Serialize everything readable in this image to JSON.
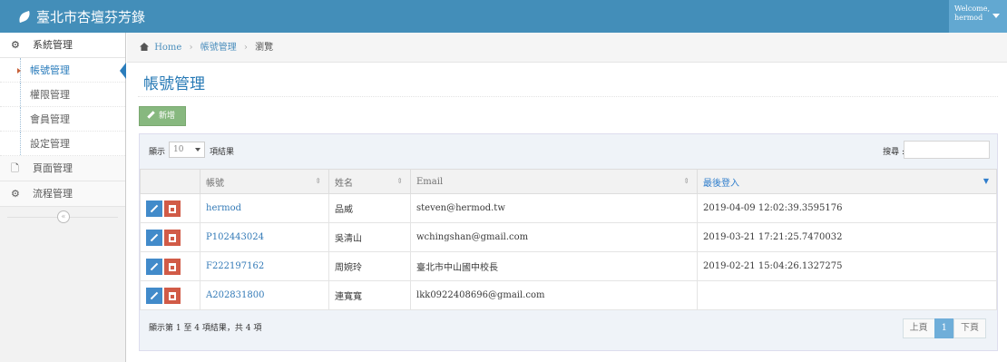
{
  "app": {
    "title": "臺北市杏壇芬芳錄"
  },
  "user_menu": {
    "welcome": "Welcome,",
    "username": "hermod"
  },
  "sidebar": {
    "system": "系統管理",
    "sub_items": [
      "帳號管理",
      "權限管理",
      "會員管理",
      "設定管理"
    ],
    "page_mgmt": "頁面管理",
    "flow_mgmt": "流程管理"
  },
  "breadcrumb": {
    "home": "Home",
    "section": "帳號管理",
    "current": "瀏覽"
  },
  "page": {
    "title": "帳號管理",
    "add_label": "新增"
  },
  "table_controls": {
    "show": "顯示",
    "length": "10",
    "results": "項結果",
    "search_label": "搜尋 :"
  },
  "columns": [
    "",
    "帳號",
    "姓名",
    "Email",
    "最後登入"
  ],
  "rows": [
    {
      "account": "hermod",
      "name": "品威",
      "email": "steven@hermod.tw",
      "last_login": "2019-04-09 12:02:39.3595176"
    },
    {
      "account": "P102443024",
      "name": "吳清山",
      "email": "wchingshan@gmail.com",
      "last_login": "2019-03-21 17:21:25.7470032"
    },
    {
      "account": "F222197162",
      "name": "周婉玲",
      "email": "臺北市中山國中校長",
      "last_login": "2019-02-21 15:04:26.1327275"
    },
    {
      "account": "A202831800",
      "name": "連寬寬",
      "email": "lkk0922408696@gmail.com",
      "last_login": ""
    }
  ],
  "footer": {
    "info": "顯示第 1 至 4 項結果，共 4 項",
    "prev": "上頁",
    "page": "1",
    "next": "下頁"
  },
  "colors": {
    "navbar": "#438eb9",
    "accent": "#2679b5",
    "add_button": "#87b87f",
    "edit_button": "#428bca",
    "delete_button": "#d15b47"
  }
}
